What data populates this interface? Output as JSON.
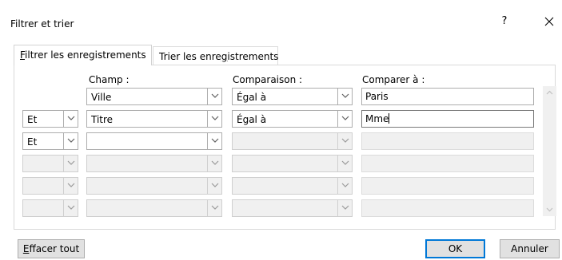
{
  "window": {
    "title": "Filtrer et trier",
    "help_glyph": "?"
  },
  "tabs": [
    {
      "label_pre": "",
      "label_key": "F",
      "label_post": "iltrer les enregistrements",
      "active": true
    },
    {
      "label_pre": "Trier les enre",
      "label_key": "g",
      "label_post": "istrements",
      "active": false
    }
  ],
  "headers": {
    "field": "Champ :",
    "comparison": "Comparaison :",
    "compare_to": "Comparer à :"
  },
  "rows": [
    {
      "operator": "",
      "field": "Ville",
      "comparison": "Égal à",
      "value": "Paris"
    },
    {
      "operator": "Et",
      "field": "Titre",
      "comparison": "Égal à",
      "value": "Mme"
    },
    {
      "operator": "Et",
      "field": "",
      "comparison": "",
      "value": ""
    },
    {
      "operator": "",
      "field": "",
      "comparison": "",
      "value": ""
    },
    {
      "operator": "",
      "field": "",
      "comparison": "",
      "value": ""
    },
    {
      "operator": "",
      "field": "",
      "comparison": "",
      "value": ""
    }
  ],
  "buttons": {
    "clear_key": "E",
    "clear_rest": "ffacer tout",
    "ok": "OK",
    "cancel": "Annuler"
  },
  "colors": {
    "default_button_border": "#0078d7",
    "disabled_fill": "#f0f0f0"
  }
}
